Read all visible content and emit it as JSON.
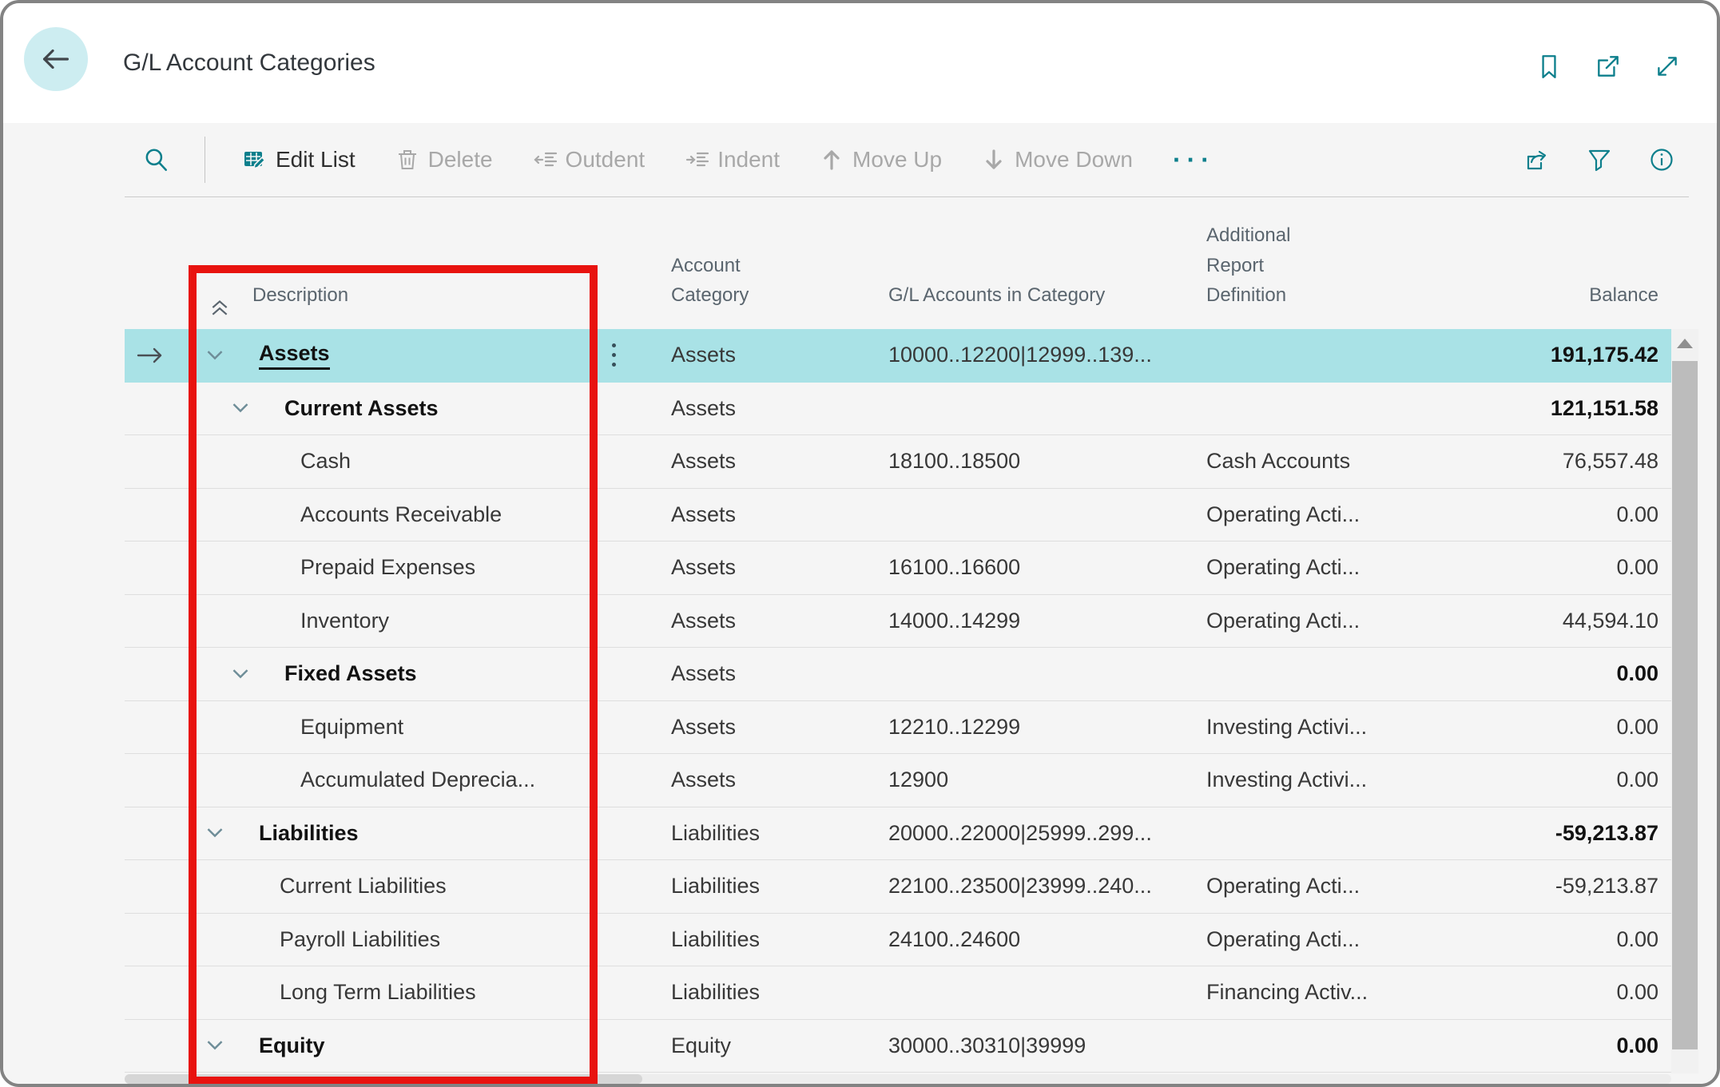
{
  "window": {
    "title": "G/L Account Categories"
  },
  "toolbar": {
    "items": [
      {
        "label": "Edit List",
        "enabled": true
      },
      {
        "label": "Delete",
        "enabled": false
      },
      {
        "label": "Outdent",
        "enabled": false
      },
      {
        "label": "Indent",
        "enabled": false
      },
      {
        "label": "Move Up",
        "enabled": false
      },
      {
        "label": "Move Down",
        "enabled": false
      }
    ],
    "more": "···"
  },
  "table": {
    "headers": {
      "description": "Description",
      "account_category": "Account\nCategory",
      "gl_accounts": "G/L Accounts in Category",
      "additional_report_definition": "Additional\nReport\nDefinition",
      "balance": "Balance"
    },
    "rows": [
      {
        "description": "Assets",
        "category": "Assets",
        "gl": "10000..12200|12999..139...",
        "ard": "",
        "balance": "191,175.42",
        "level": 0,
        "bold": true,
        "expandable": true,
        "selected": true
      },
      {
        "description": "Current Assets",
        "category": "Assets",
        "gl": "",
        "ard": "",
        "balance": "121,151.58",
        "level": 1,
        "bold": true,
        "expandable": true,
        "selected": false
      },
      {
        "description": "Cash",
        "category": "Assets",
        "gl": "18100..18500",
        "ard": "Cash Accounts",
        "balance": "76,557.48",
        "level": 2,
        "bold": false,
        "expandable": false,
        "selected": false
      },
      {
        "description": "Accounts Receivable",
        "category": "Assets",
        "gl": "",
        "ard": "Operating Acti...",
        "balance": "0.00",
        "level": 2,
        "bold": false,
        "expandable": false,
        "selected": false
      },
      {
        "description": "Prepaid Expenses",
        "category": "Assets",
        "gl": "16100..16600",
        "ard": "Operating Acti...",
        "balance": "0.00",
        "level": 2,
        "bold": false,
        "expandable": false,
        "selected": false
      },
      {
        "description": "Inventory",
        "category": "Assets",
        "gl": "14000..14299",
        "ard": "Operating Acti...",
        "balance": "44,594.10",
        "level": 2,
        "bold": false,
        "expandable": false,
        "selected": false
      },
      {
        "description": "Fixed Assets",
        "category": "Assets",
        "gl": "",
        "ard": "",
        "balance": "0.00",
        "level": 1,
        "bold": true,
        "expandable": true,
        "selected": false
      },
      {
        "description": "Equipment",
        "category": "Assets",
        "gl": "12210..12299",
        "ard": "Investing Activi...",
        "balance": "0.00",
        "level": 2,
        "bold": false,
        "expandable": false,
        "selected": false
      },
      {
        "description": "Accumulated Deprecia...",
        "category": "Assets",
        "gl": "12900",
        "ard": "Investing Activi...",
        "balance": "0.00",
        "level": 2,
        "bold": false,
        "expandable": false,
        "selected": false
      },
      {
        "description": "Liabilities",
        "category": "Liabilities",
        "gl": "20000..22000|25999..299...",
        "ard": "",
        "balance": "-59,213.87",
        "level": 0,
        "bold": true,
        "expandable": true,
        "selected": false
      },
      {
        "description": "Current Liabilities",
        "category": "Liabilities",
        "gl": "22100..23500|23999..240...",
        "ard": "Operating Acti...",
        "balance": "-59,213.87",
        "level": 1,
        "bold": false,
        "expandable": false,
        "selected": false
      },
      {
        "description": "Payroll Liabilities",
        "category": "Liabilities",
        "gl": "24100..24600",
        "ard": "Operating Acti...",
        "balance": "0.00",
        "level": 1,
        "bold": false,
        "expandable": false,
        "selected": false
      },
      {
        "description": "Long Term Liabilities",
        "category": "Liabilities",
        "gl": "",
        "ard": "Financing Activ...",
        "balance": "0.00",
        "level": 1,
        "bold": false,
        "expandable": false,
        "selected": false
      },
      {
        "description": "Equity",
        "category": "Equity",
        "gl": "30000..30310|39999",
        "ard": "",
        "balance": "0.00",
        "level": 0,
        "bold": true,
        "expandable": true,
        "selected": false
      }
    ]
  },
  "colors": {
    "accent": "#0d7f8c",
    "selected_row": "#a9e2e6",
    "annotation": "#e8130f"
  }
}
